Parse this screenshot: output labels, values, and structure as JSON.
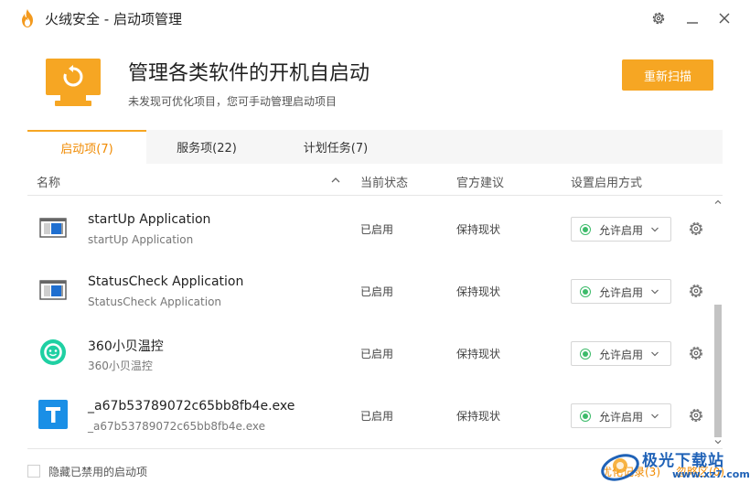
{
  "window": {
    "title": "火绒安全 - 启动项管理"
  },
  "header": {
    "title": "管理各类软件的开机自启动",
    "subtitle": "未发现可优化项目，您可手动管理启动项目",
    "rescan_label": "重新扫描"
  },
  "tabs": [
    {
      "label": "启动项(7)",
      "active": true
    },
    {
      "label": "服务项(22)",
      "active": false
    },
    {
      "label": "计划任务(7)",
      "active": false
    }
  ],
  "table": {
    "columns": [
      "名称",
      "当前状态",
      "官方建议",
      "设置启用方式"
    ],
    "rows": [
      {
        "name": "startUp Application",
        "sub": "startUp Application",
        "status": "已启用",
        "advice": "保持现状",
        "mode": "允许启用",
        "icon": "window-app-icon"
      },
      {
        "name": "StatusCheck Application",
        "sub": "StatusCheck Application",
        "status": "已启用",
        "advice": "保持现状",
        "mode": "允许启用",
        "icon": "window-app-icon"
      },
      {
        "name": "360小贝温控",
        "sub": "360小贝温控",
        "status": "已启用",
        "advice": "保持现状",
        "mode": "允许启用",
        "icon": "360-temp-icon"
      },
      {
        "name": "_a67b53789072c65bb8fb4e.exe",
        "sub": "_a67b53789072c65bb8fb4e.exe",
        "status": "已启用",
        "advice": "保持现状",
        "mode": "允许启用",
        "icon": "t-app-icon"
      }
    ]
  },
  "footer": {
    "hide_disabled_label": "隐藏已禁用的启动项",
    "optimize_record": "优化记录(3)",
    "ignore_zone": "忽略区(0)"
  },
  "watermark": {
    "line1": "极光下载站",
    "line2": "www.xz7.com"
  },
  "colors": {
    "accent": "#f6a623",
    "accent_text": "#f08a00",
    "enabled_green": "#3dbb6a",
    "scrollbar": "#c3c3c3"
  }
}
